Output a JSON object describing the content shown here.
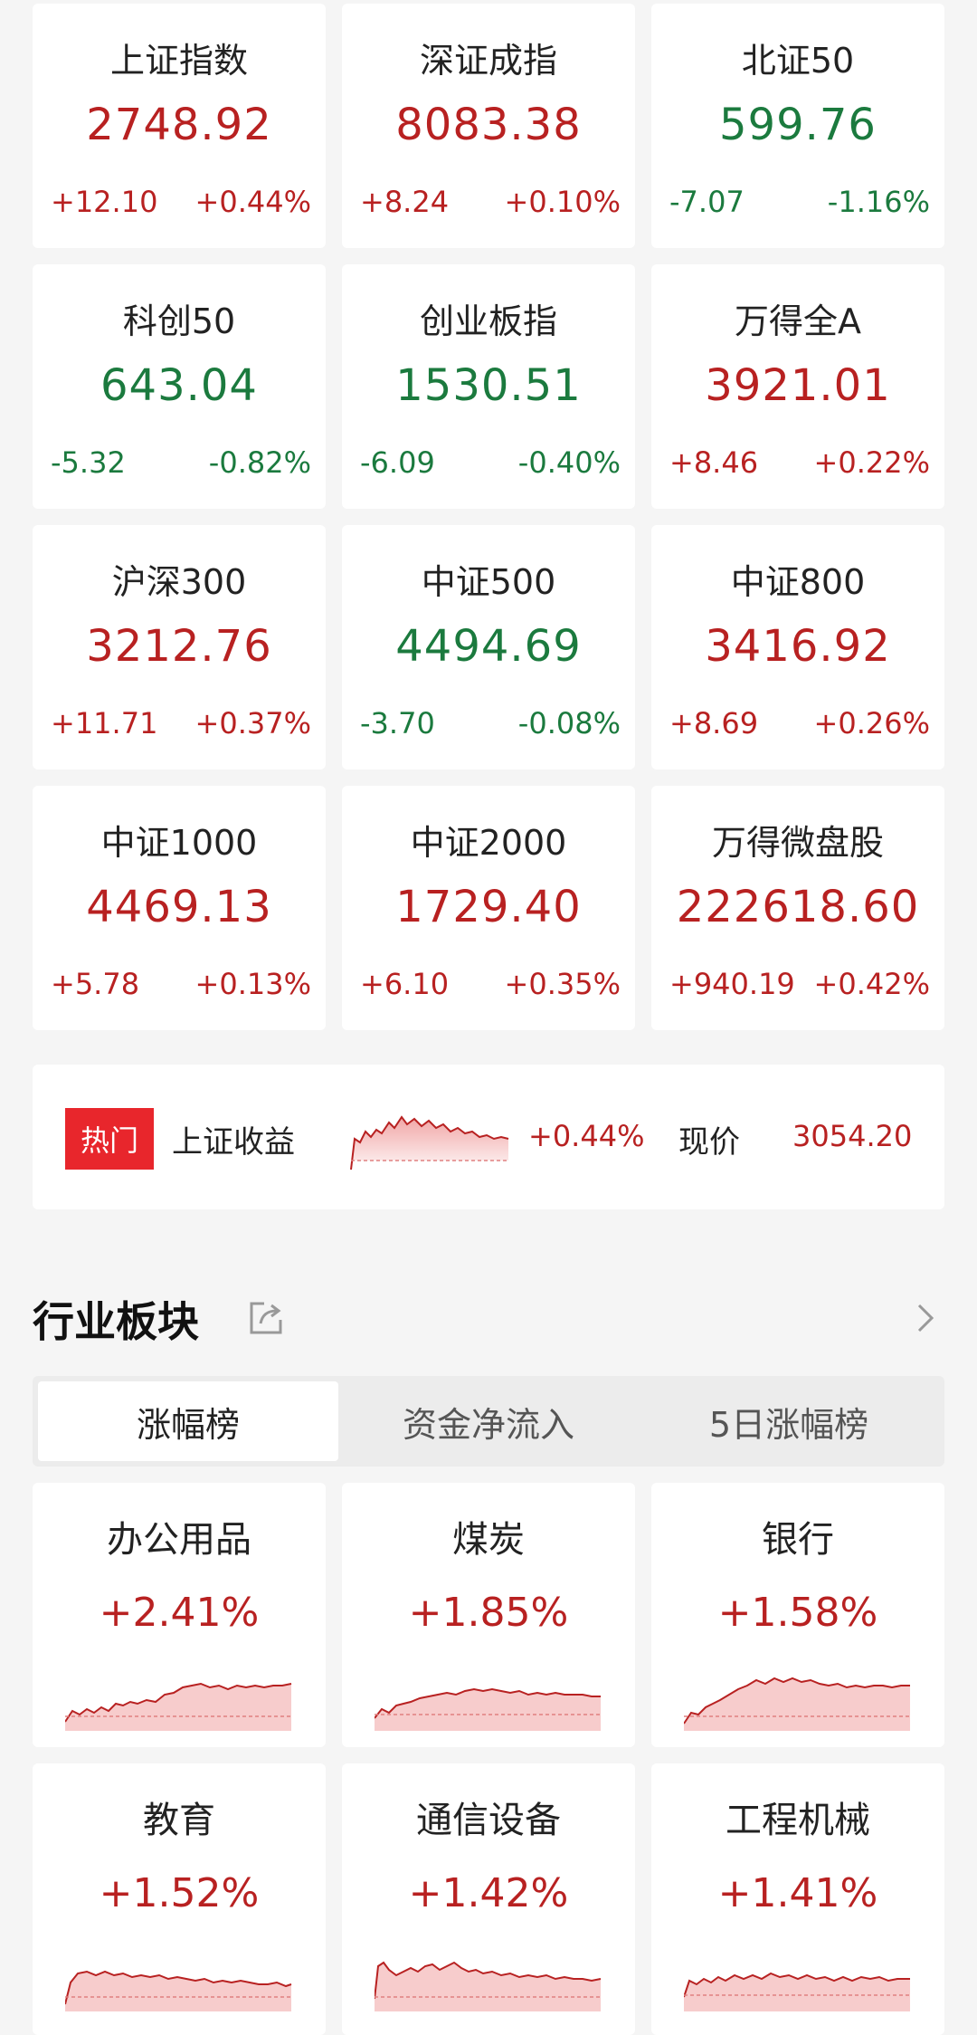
{
  "colors": {
    "up": "#b82121",
    "down": "#1b7a3e",
    "badge": "#e8262c"
  },
  "indices": [
    {
      "name": "上证指数",
      "value": "2748.92",
      "change": "+12.10",
      "pct": "+0.44%",
      "dir": "up"
    },
    {
      "name": "深证成指",
      "value": "8083.38",
      "change": "+8.24",
      "pct": "+0.10%",
      "dir": "up"
    },
    {
      "name": "北证50",
      "value": "599.76",
      "change": "-7.07",
      "pct": "-1.16%",
      "dir": "down"
    },
    {
      "name": "科创50",
      "value": "643.04",
      "change": "-5.32",
      "pct": "-0.82%",
      "dir": "down"
    },
    {
      "name": "创业板指",
      "value": "1530.51",
      "change": "-6.09",
      "pct": "-0.40%",
      "dir": "down"
    },
    {
      "name": "万得全A",
      "value": "3921.01",
      "change": "+8.46",
      "pct": "+0.22%",
      "dir": "up"
    },
    {
      "name": "沪深300",
      "value": "3212.76",
      "change": "+11.71",
      "pct": "+0.37%",
      "dir": "up"
    },
    {
      "name": "中证500",
      "value": "4494.69",
      "change": "-3.70",
      "pct": "-0.08%",
      "dir": "down"
    },
    {
      "name": "中证800",
      "value": "3416.92",
      "change": "+8.69",
      "pct": "+0.26%",
      "dir": "up"
    },
    {
      "name": "中证1000",
      "value": "4469.13",
      "change": "+5.78",
      "pct": "+0.13%",
      "dir": "up"
    },
    {
      "name": "中证2000",
      "value": "1729.40",
      "change": "+6.10",
      "pct": "+0.35%",
      "dir": "up"
    },
    {
      "name": "万得微盘股",
      "value": "222618.60",
      "change": "+940.19",
      "pct": "+0.42%",
      "dir": "up"
    }
  ],
  "hot": {
    "badge": "热门",
    "name": "上证收益",
    "pct": "+0.44%",
    "price_label": "现价",
    "price": "3054.20"
  },
  "section": {
    "title": "行业板块"
  },
  "tabs": [
    {
      "label": "涨幅榜",
      "active": true
    },
    {
      "label": "资金净流入",
      "active": false
    },
    {
      "label": "5日涨幅榜",
      "active": false
    }
  ],
  "sectors": [
    {
      "name": "办公用品",
      "pct": "+2.41%"
    },
    {
      "name": "煤炭",
      "pct": "+1.85%"
    },
    {
      "name": "银行",
      "pct": "+1.58%"
    },
    {
      "name": "教育",
      "pct": "+1.52%"
    },
    {
      "name": "通信设备",
      "pct": "+1.42%"
    },
    {
      "name": "工程机械",
      "pct": "+1.41%"
    }
  ],
  "icons": {
    "share": "share-icon",
    "chevron": "chevron-right-icon"
  }
}
